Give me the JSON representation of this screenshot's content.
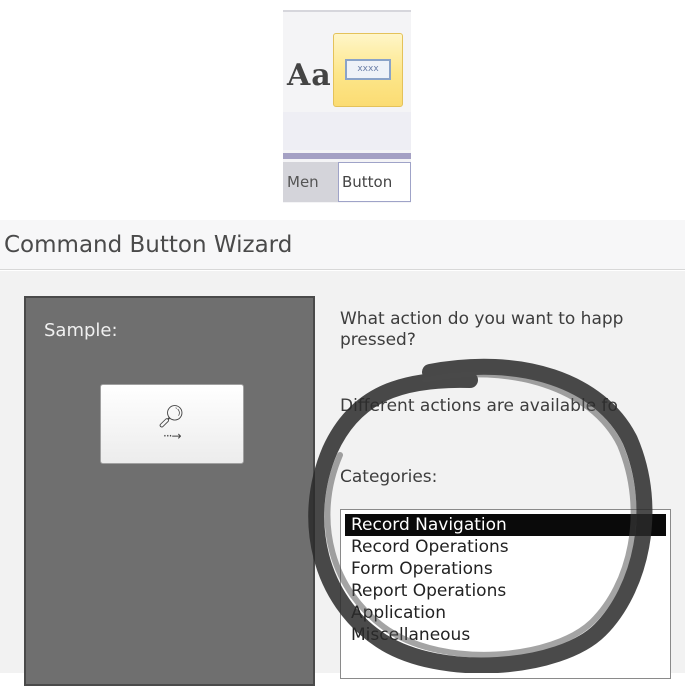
{
  "ribbon": {
    "font_icon_text": "Aa",
    "button_control_caption": "xxxx",
    "tabs": [
      {
        "label": "Men"
      },
      {
        "label": "Button"
      }
    ]
  },
  "wizard": {
    "title": "Command Button Wizard",
    "sample_label": "Sample:",
    "sample_button_icon": "binoculars-icon",
    "question": "What action do you want to happ pressed?",
    "question_line1": "What action do you want to happ",
    "question_line2": "pressed?",
    "different_actions": "Different actions are available fo",
    "categories_label": "Categories:",
    "categories": [
      {
        "label": "Record Navigation",
        "selected": true
      },
      {
        "label": "Record Operations",
        "selected": false
      },
      {
        "label": "Form Operations",
        "selected": false
      },
      {
        "label": "Report Operations",
        "selected": false
      },
      {
        "label": "Application",
        "selected": false
      },
      {
        "label": "Miscellaneous",
        "selected": false
      }
    ]
  },
  "colors": {
    "selected_row": "#0a0a0a",
    "sample_panel": "#6f6f6f",
    "ribbon_highlight": "#fde68a",
    "ink": "#2a2a2a"
  }
}
